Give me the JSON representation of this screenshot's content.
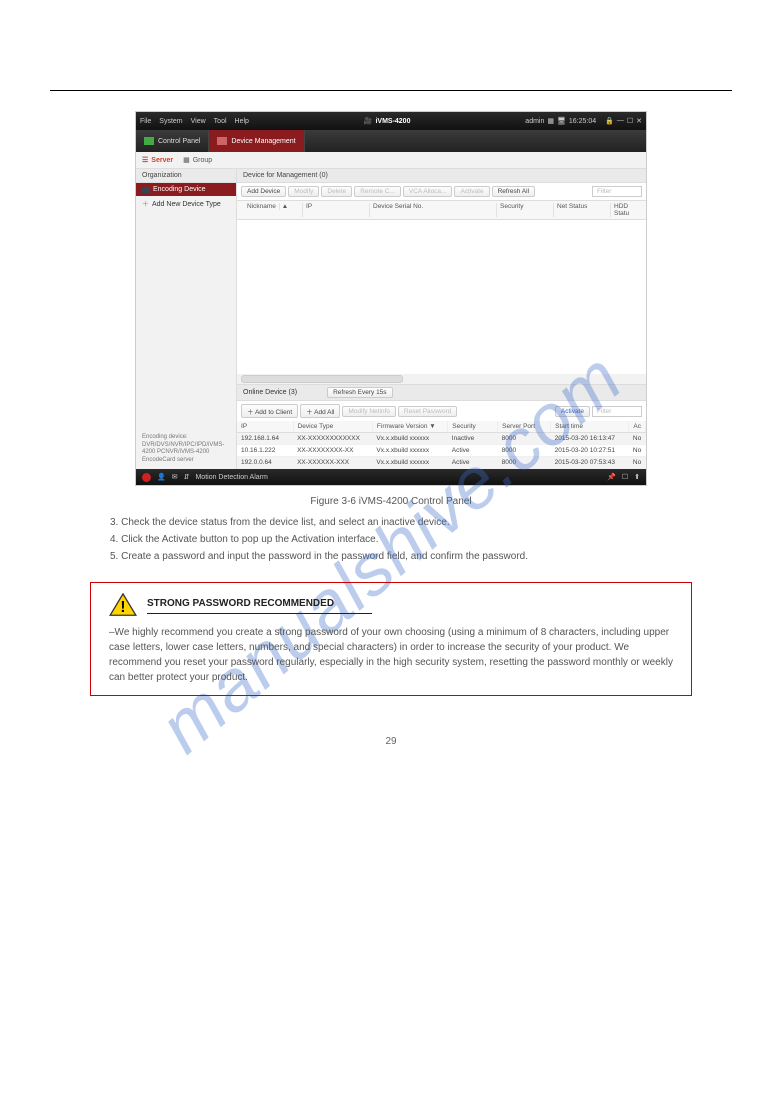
{
  "watermark": "manualshive.com",
  "page_number": "29",
  "app": {
    "title": "iVMS-4200",
    "menubar": [
      "File",
      "System",
      "View",
      "Tool",
      "Help"
    ],
    "user": "admin",
    "time": "16:25:04",
    "tabs": {
      "control_panel": "Control Panel",
      "device_mgmt": "Device Management"
    },
    "sub_tabs": {
      "server": "Server",
      "group": "Group"
    },
    "sidebar": {
      "organization": "Organization",
      "encoding_device": "Encoding Device",
      "add_new_type": "Add New Device Type",
      "footer_line1": "Encoding device:",
      "footer_line2": "DVR/DVS/NVR/IPC/IPD/iVMS-4200 PCNVR/iVMS-4200 EncodeCard server"
    },
    "main": {
      "panel_title": "Device for Management (0)",
      "toolbar": {
        "add_device": "Add Device",
        "modify": "Modify",
        "delete": "Delete",
        "remote_c": "Remote C...",
        "vca_alloca": "VCA Alloca...",
        "activate": "Activate",
        "refresh_all": "Refresh All",
        "filter": "Filter"
      },
      "columns": {
        "nickname": "Nickname",
        "ip": "IP",
        "serial": "Device Serial No.",
        "security": "Security",
        "net_status": "Net Status",
        "hdd_status": "HDD Statu"
      }
    },
    "online": {
      "title": "Online Device (3)",
      "refresh": "Refresh Every 15s",
      "toolbar": {
        "add_to_client": "Add to Client",
        "add_all": "Add All",
        "modify_netinfo": "Modify Netinfo",
        "reset_password": "Reset Password",
        "activate": "Activate",
        "filter": "Filter"
      },
      "columns": {
        "ip": "IP",
        "device_type": "Device Type",
        "firmware": "Firmware Version",
        "security": "Security",
        "server_port": "Server Port",
        "start_time": "Start time",
        "ac": "Ac"
      },
      "rows": [
        {
          "ip": "192.168.1.64",
          "type": "XX-XXXXXXXXXXXX",
          "fw": "Vx.x.xbuild xxxxxx",
          "security": "Inactive",
          "port": "8000",
          "start": "2015-03-20 16:13:47",
          "ac": "No"
        },
        {
          "ip": "10.16.1.222",
          "type": "XX-XXXXXXXX-XX",
          "fw": "Vx.x.xbuild xxxxxx",
          "security": "Active",
          "port": "8000",
          "start": "2015-03-20 10:27:51",
          "ac": "No"
        },
        {
          "ip": "192.0.0.64",
          "type": "XX-XXXXXX-XXX",
          "fw": "Vx.x.xbuild xxxxxx",
          "security": "Active",
          "port": "8000",
          "start": "2015-03-20 07:53:43",
          "ac": "No"
        }
      ]
    },
    "statusbar": {
      "alarm": "Motion Detection Alarm"
    }
  },
  "caption": "Figure 3-6 iVMS-4200 Control Panel",
  "steps": {
    "s3": "3. Check the device status from the device list, and select an inactive device.",
    "s4": "4. Click the Activate button to pop up the Activation interface.",
    "s5": "5. Create a password and input the password in the password field, and confirm the password."
  },
  "warning": {
    "title": "STRONG PASSWORD RECOMMENDED",
    "body": "–We highly recommend you create a strong password of your own choosing (using a minimum of 8 characters, including upper case letters, lower case letters, numbers, and special characters) in order to increase the security of your product. We recommend you reset your password regularly, especially in the high security system, resetting the password monthly or weekly can better protect your product."
  }
}
